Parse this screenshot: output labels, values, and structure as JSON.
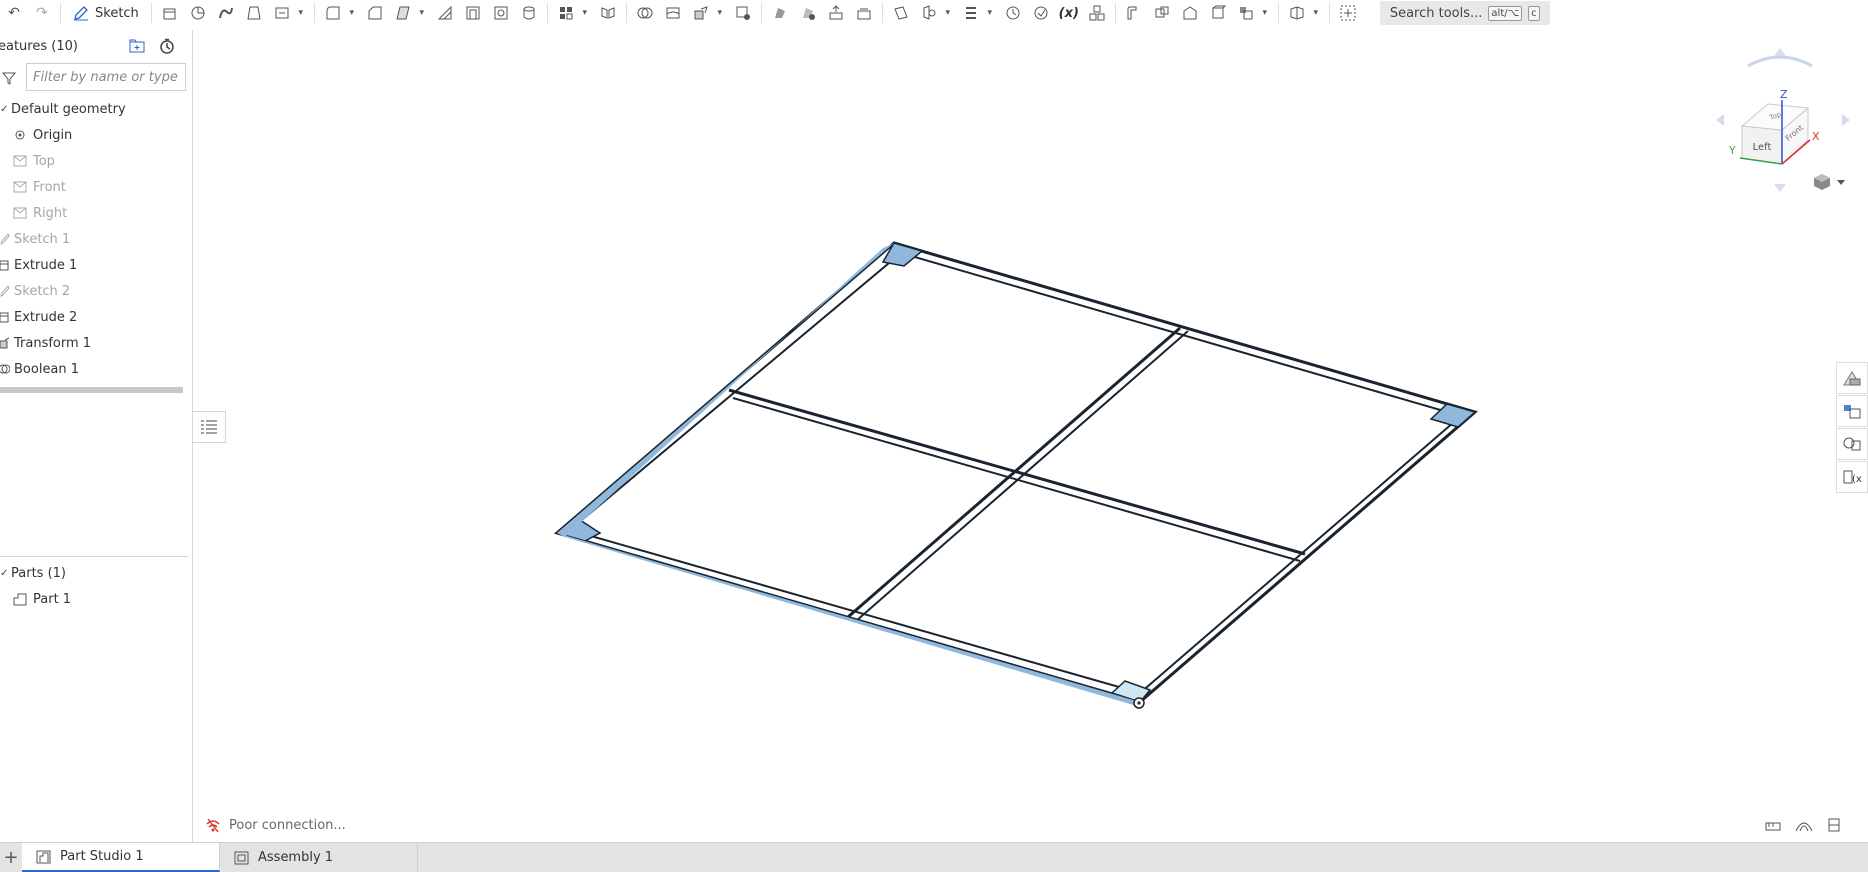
{
  "toolbar": {
    "sketch_label": "Sketch",
    "search_label": "Search tools...",
    "search_shortcut_1": "alt/⌥",
    "search_shortcut_2": "c"
  },
  "feature_panel": {
    "title": "eatures (10)",
    "filter_placeholder": "Filter by name or type",
    "items": [
      {
        "label": "Default geometry",
        "icon": "chevron-down-icon",
        "state": "normal"
      },
      {
        "label": "Origin",
        "icon": "origin-icon",
        "state": "normal"
      },
      {
        "label": "Top",
        "icon": "plane-icon",
        "state": "disabled"
      },
      {
        "label": "Front",
        "icon": "plane-icon",
        "state": "disabled"
      },
      {
        "label": "Right",
        "icon": "plane-icon",
        "state": "disabled"
      },
      {
        "label": "Sketch 1",
        "icon": "sketch-icon",
        "state": "disabled"
      },
      {
        "label": "Extrude 1",
        "icon": "extrude-icon",
        "state": "normal"
      },
      {
        "label": "Sketch 2",
        "icon": "sketch-icon",
        "state": "disabled"
      },
      {
        "label": "Extrude 2",
        "icon": "extrude-icon",
        "state": "normal"
      },
      {
        "label": "Transform 1",
        "icon": "transform-icon",
        "state": "normal"
      },
      {
        "label": "Boolean 1",
        "icon": "boolean-icon",
        "state": "normal"
      }
    ],
    "parts_header": "Parts (1)",
    "parts": [
      {
        "label": "Part 1",
        "icon": "part-icon"
      }
    ]
  },
  "viewport": {
    "status_text": "Poor connection...",
    "viewcube": {
      "front_face": "Left",
      "right_face": "Front",
      "top_face": "Top",
      "axis_x": "X",
      "axis_y": "Y",
      "axis_z": "Z"
    }
  },
  "tabs": [
    {
      "label": "Part Studio 1",
      "active": true,
      "icon": "part-studio-icon"
    },
    {
      "label": "Assembly 1",
      "active": false,
      "icon": "assembly-icon"
    }
  ],
  "colors": {
    "model_face": "#8fb8dc",
    "model_edge": "#1a2430",
    "tab_active_underline": "#2b66c8",
    "axis_x": "#d9342b",
    "axis_y": "#3aa04a",
    "axis_z": "#2f4fd6"
  }
}
